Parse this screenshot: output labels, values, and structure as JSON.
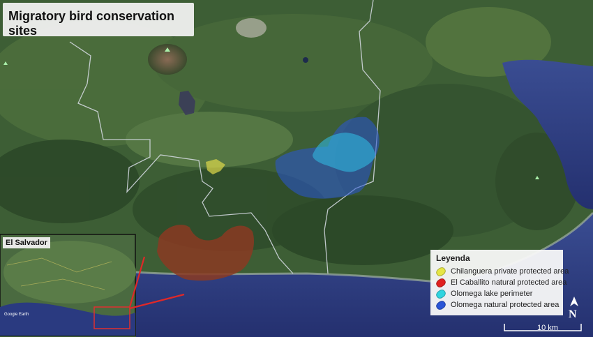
{
  "title": "Migratory bird conservation sites",
  "inset": {
    "label": "El Salvador"
  },
  "legend": {
    "title": "Leyenda",
    "items": [
      {
        "label": "Chilanguera private protected area",
        "color": "#e6e645"
      },
      {
        "label": "El Caballito natural protected area",
        "color": "#e02020"
      },
      {
        "label": "Olomega lake perimeter",
        "color": "#30d4e0"
      },
      {
        "label": "Olomega natural protected area",
        "color": "#2a55d6"
      }
    ]
  },
  "scale": {
    "label": "10 km"
  },
  "north": {
    "label": "N"
  },
  "colors": {
    "terrain": "#3d5e35",
    "sea": "#2e3d8a",
    "boundary": "#d8dde6"
  }
}
